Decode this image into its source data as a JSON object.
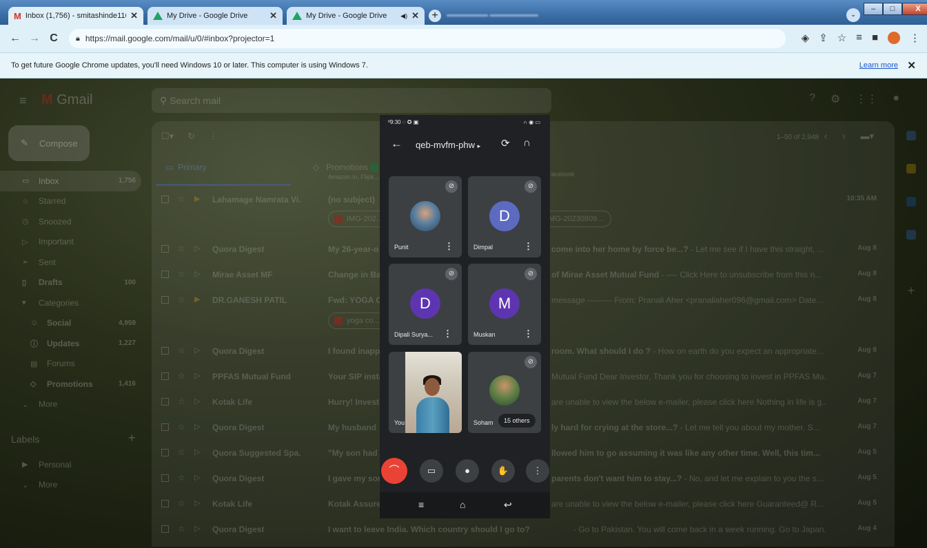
{
  "browser": {
    "tabs": [
      {
        "title": "Inbox (1,756) - smitashinde1168...",
        "icon": "gmail-icon",
        "close": "✕"
      },
      {
        "title": "My Drive - Google Drive",
        "icon": "drive-icon",
        "close": "✕"
      },
      {
        "title": "My Drive - Google Drive",
        "icon": "drive-icon",
        "close": "✕",
        "audio": "◀)"
      }
    ],
    "new_tab": "+",
    "url": "https://mail.google.com/mail/u/0/#inbox?projector=1",
    "window_buttons": {
      "minimize": "–",
      "maximize": "□",
      "close": "X"
    }
  },
  "infobar": {
    "message": "To get future Google Chrome updates, you'll need Windows 10 or later. This computer is using Windows 7.",
    "learn_more": "Learn more",
    "close": "✕"
  },
  "gmail": {
    "logo_text": "Gmail",
    "search_placeholder": "Search mail",
    "compose_label": "Compose",
    "sidebar": [
      {
        "label": "Inbox",
        "count": "1,756",
        "icon": "▭",
        "active": true
      },
      {
        "label": "Starred",
        "count": "",
        "icon": "☆"
      },
      {
        "label": "Snoozed",
        "count": "",
        "icon": "◷"
      },
      {
        "label": "Important",
        "count": "",
        "icon": "▷"
      },
      {
        "label": "Sent",
        "count": "",
        "icon": "➢"
      },
      {
        "label": "Drafts",
        "count": "100",
        "icon": "▯",
        "bold": true
      },
      {
        "label": "Categories",
        "count": "",
        "icon": "▾"
      },
      {
        "label": "Social",
        "count": "4,959",
        "icon": "☺",
        "indent": true,
        "bold": true
      },
      {
        "label": "Updates",
        "count": "1,227",
        "icon": "ⓘ",
        "indent": true,
        "bold": true
      },
      {
        "label": "Forums",
        "count": "",
        "icon": "▤",
        "indent": true
      },
      {
        "label": "Promotions",
        "count": "1,416",
        "icon": "◇",
        "indent": true,
        "bold": true
      },
      {
        "label": "More",
        "count": "",
        "icon": "⌄"
      }
    ],
    "labels_header": "Labels",
    "labels": [
      {
        "label": "Personal",
        "icon": "▶"
      },
      {
        "label": "More",
        "icon": "⌄"
      }
    ],
    "pagination": "1–50 of 2,948",
    "tabs": {
      "primary": "Primary",
      "promotions": "Promotions",
      "promotions_sub": "Amazon.in, Flipk...",
      "social_sub": "Facebook"
    },
    "rows": [
      {
        "sender": "Lahamage Namrata Vi.",
        "subject": "(no subject)",
        "snippet_bold": "",
        "snippet": "",
        "date": "10:35 AM",
        "important": true,
        "attachments": [
          "IMG-202...",
          "IMG-20230809..."
        ]
      },
      {
        "sender": "Quora Digest",
        "subject": "My 26-year-o",
        "snippet_bold": "come into her home by force be...?",
        "snippet": " - Let me see if I have this straight, ...",
        "date": "Aug 8"
      },
      {
        "sender": "Mirae Asset MF",
        "subject": "Change in Ba",
        "snippet_bold": "of Mirae Asset Mutual Fund",
        "snippet": " - ---- Click Here to unsubscribe from this n...",
        "date": "Aug 8"
      },
      {
        "sender": "DR.GANESH PATIL",
        "subject": "Fwd: YOGA C",
        "snippet_bold": "",
        "snippet": "message --------- From: Pranali Aher <pranaliaher096@gmail.com> Date...",
        "date": "Aug 8",
        "important": true,
        "attachments": [
          "yoga co..."
        ]
      },
      {
        "sender": "Quora Digest",
        "subject": "I found inapp",
        "snippet_bold": "room. What should I do ?",
        "snippet": " - How on earth do you expect an appropriate...",
        "date": "Aug 8"
      },
      {
        "sender": "PPFAS Mutual Fund",
        "subject": "Your SIP insta",
        "snippet_bold": "",
        "snippet": "Mutual Fund Dear Investor, Thank you for choosing to invest in PPFAS Mu...",
        "date": "Aug 7"
      },
      {
        "sender": "Kotak Life",
        "subject": "Hurry! Invest",
        "snippet_bold": "",
        "snippet": "are unable to view the below e-mailer, please click here Nothing in life is g...",
        "date": "Aug 7"
      },
      {
        "sender": "Quora Digest",
        "subject": "My husband",
        "snippet_bold": "ly hard for crying at the store...?",
        "snippet": " - Let me tell you about my mother. S...",
        "date": "Aug 7"
      },
      {
        "sender": "Quora Suggested Spa.",
        "subject": "\"My son had",
        "snippet_bold": "llowed him to go assuming it was like any other time. Well, this tim...",
        "snippet": "",
        "date": "Aug 5"
      },
      {
        "sender": "Quora Digest",
        "subject": "I gave my son",
        "snippet_bold": "parents don't want him to stay...?",
        "snippet": " - No, and let me explain to you the s...",
        "date": "Aug 5"
      },
      {
        "sender": "Kotak Life",
        "subject": "Kotak Assure",
        "snippet_bold": "",
        "snippet": "are unable to view the below e-mailer, please click here Guaranteed@ R...",
        "date": "Aug 5"
      },
      {
        "sender": "Quora Digest",
        "subject": "I want to leave India. Which country should I go to?",
        "snippet_bold": "",
        "snippet": " - Go to Pakistan. You will come back in a week running. Go to Japan. You ca...",
        "date": "Aug 4"
      }
    ]
  },
  "meet": {
    "status_time": "9:30",
    "status_icons_left": "◌ ✪ ▣",
    "status_icons_right": "∩ ◉ ▭",
    "meeting_code": "qeb-mvfm-phw",
    "meeting_code_arrow": "▸",
    "participants": [
      {
        "name": "Punit",
        "initial": "",
        "color": "",
        "muted": true
      },
      {
        "name": "Dimpal",
        "initial": "D",
        "color": "#5c6bc0",
        "muted": true
      },
      {
        "name": "Dipali Surya...",
        "initial": "D",
        "color": "#5e35b1",
        "muted": true
      },
      {
        "name": "Muskan",
        "initial": "M",
        "color": "#5e35b1",
        "muted": true
      },
      {
        "name": "You",
        "initial": "",
        "color": "",
        "muted": false
      },
      {
        "name": "Soham",
        "initial": "",
        "color": "",
        "muted": true
      }
    ],
    "others_label": "15 others",
    "controls": {
      "end": "⌒",
      "camera": "▭",
      "mic": "●",
      "hand": "✋",
      "more": "⋮"
    },
    "navbar": {
      "menu": "≡",
      "home": "⌂",
      "back": "↩"
    }
  }
}
